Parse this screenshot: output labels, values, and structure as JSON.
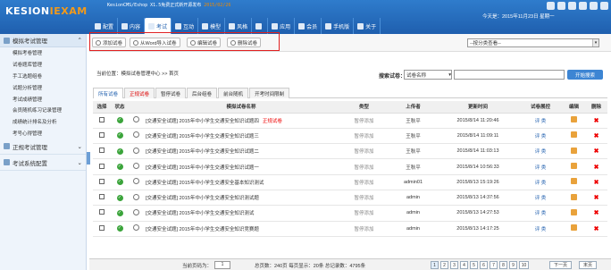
{
  "header": {
    "logo_main": "KESION",
    "logo_accent": "IEXAM",
    "notice": "KesionCMS/Eshop X1.5免费正式新开源发布",
    "notice_date": "2015/02/26",
    "today": "今天是：2015年11月23日 星期一"
  },
  "nav": [
    "配置",
    "内容",
    "考试",
    "互动",
    "模型",
    "风格",
    "",
    "应用",
    "会员",
    "手机版",
    "关于"
  ],
  "sidebar": {
    "section1": "模拟考试管理",
    "items": [
      "模拟考卷管理",
      "试卷题库管理",
      "手工选题组卷",
      "试题分析管理",
      "考试成绩管理",
      "会员随机练习记录管理",
      "成绩统计排名及分析",
      "考号心得管理"
    ],
    "section2": "正规考试管理",
    "section3": "考试系统配置"
  },
  "toolbar": {
    "add": "添加试卷",
    "import": "从Word导入试卷",
    "edit": "编辑试卷",
    "delete": "删除试卷",
    "category_select": "--按分类查看--"
  },
  "breadcrumb": "当前位置：模拟试卷管理中心 >> 首页",
  "search": {
    "label": "搜索试卷：",
    "field": "试卷名称",
    "button": "开始搜索"
  },
  "tabs": [
    "所有试卷",
    "正规试卷",
    "暂停试卷",
    "后台组卷",
    "前台随机",
    "开考时间限制"
  ],
  "table": {
    "headers": [
      "选择",
      "状态",
      "",
      "模拟试卷名称",
      "类型",
      "上传者",
      "更新时间",
      "试卷展控",
      "编辑",
      "删除"
    ],
    "rows": [
      {
        "name": "[交通安全试题] 2015年中小学生交通安全知识试题四",
        "tag": "正规试卷",
        "type": "暂停添加",
        "user": "王秋平",
        "time": "2015/8/14 11:20:46",
        "rev": "评 类"
      },
      {
        "name": "[交通安全试题] 2015年中小学生交通安全知识试题三",
        "tag": "",
        "type": "暂停添加",
        "user": "王秋平",
        "time": "2015/8/14 11:09:11",
        "rev": "评 类"
      },
      {
        "name": "[交通安全试题] 2015年中小学生交通安全知识试题二",
        "tag": "",
        "type": "暂停添加",
        "user": "王秋平",
        "time": "2015/8/14 11:03:13",
        "rev": "评 类"
      },
      {
        "name": "[交通安全试题] 2015年中小学生交通安全知识试题一",
        "tag": "",
        "type": "暂停添加",
        "user": "王秋平",
        "time": "2015/8/14 10:56:33",
        "rev": "评 类"
      },
      {
        "name": "[交通安全试题] 2015年中小学生交通安全基本知识测试",
        "tag": "",
        "type": "暂停添加",
        "user": "admin01",
        "time": "2015/8/13 15:19:26",
        "rev": "评 类"
      },
      {
        "name": "[交通安全试题] 2015年中小学生交通安全知识测试题",
        "tag": "",
        "type": "暂停添加",
        "user": "admin",
        "time": "2015/8/13 14:37:56",
        "rev": "评 类"
      },
      {
        "name": "[交通安全试题] 2015年中小学生交通安全知识测试",
        "tag": "",
        "type": "暂停添加",
        "user": "admin",
        "time": "2015/8/13 14:27:53",
        "rev": "评 类"
      },
      {
        "name": "[交通安全试题] 2015年中小学生交通安全知识竞赛题",
        "tag": "",
        "type": "暂停添加",
        "user": "admin",
        "time": "2015/8/13 14:17:25",
        "rev": "评 类"
      }
    ]
  },
  "pager": {
    "label": "当前页码为：",
    "current": "1",
    "summary": "总页数：240页 每页显示：20条 总记录数：4795条",
    "pages": [
      "1",
      "2",
      "3",
      "4",
      "5",
      "6",
      "7",
      "8",
      "9",
      "10"
    ],
    "next": "下一页",
    "last": "末页"
  }
}
